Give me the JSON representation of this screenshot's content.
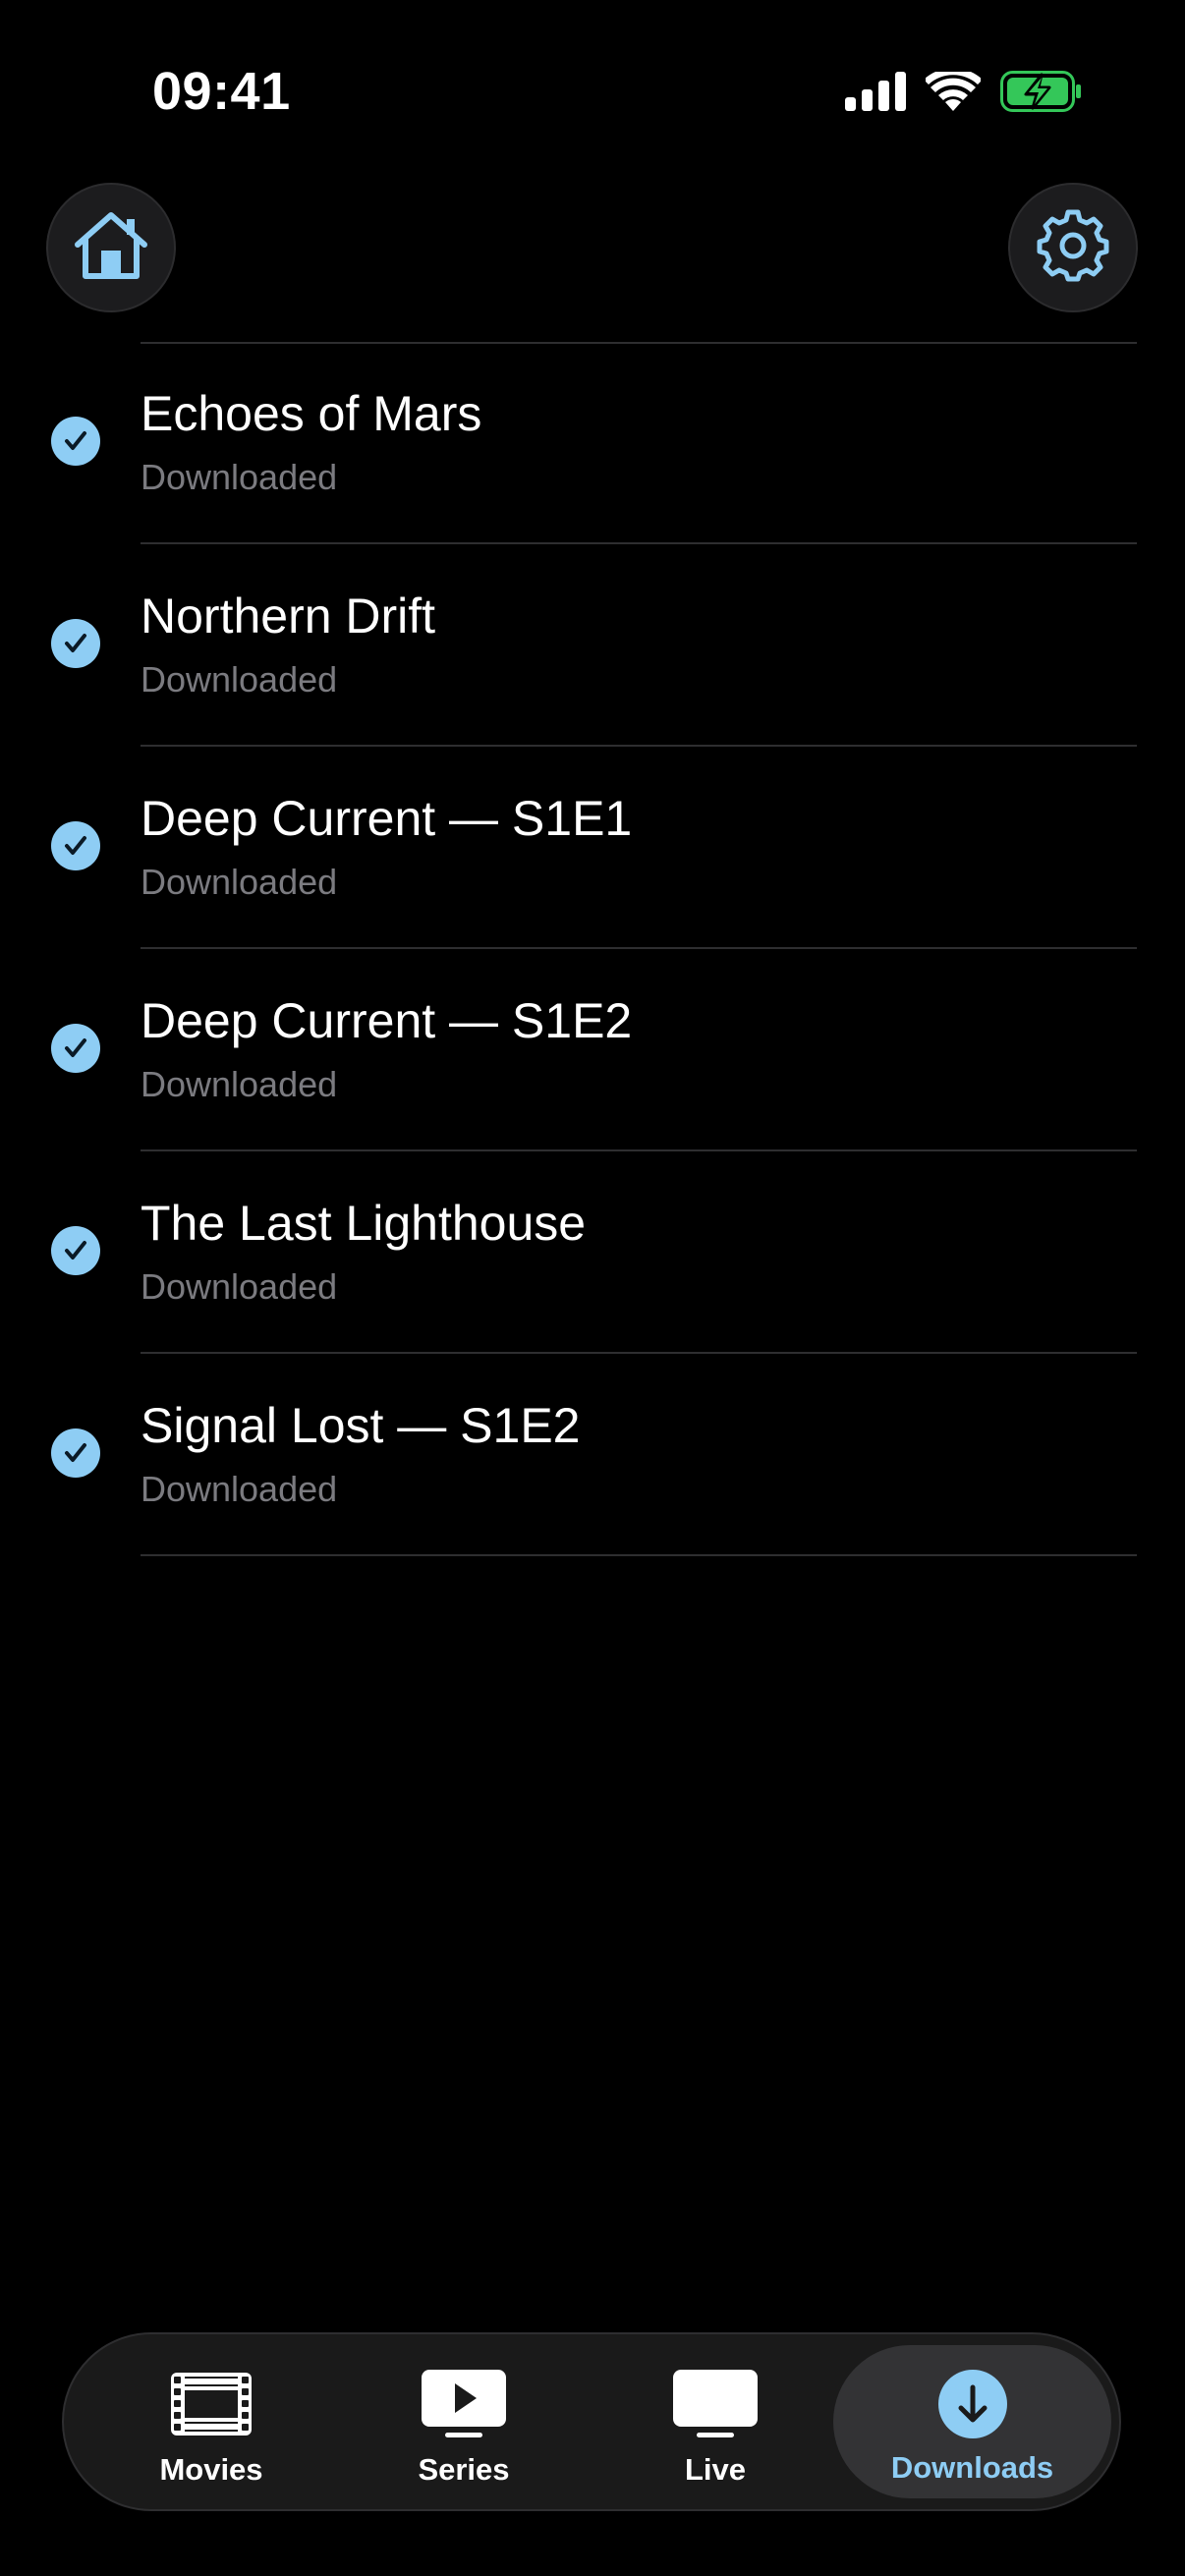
{
  "status_bar": {
    "time": "09:41"
  },
  "header": {
    "home_icon": "house-icon",
    "settings_icon": "gear-icon"
  },
  "downloads": {
    "items": [
      {
        "title": "Echoes of Mars",
        "status": "Downloaded"
      },
      {
        "title": "Northern Drift",
        "status": "Downloaded"
      },
      {
        "title": "Deep Current — S1E1",
        "status": "Downloaded"
      },
      {
        "title": "Deep Current — S1E2",
        "status": "Downloaded"
      },
      {
        "title": "The Last Lighthouse",
        "status": "Downloaded"
      },
      {
        "title": "Signal Lost — S1E2",
        "status": "Downloaded"
      }
    ]
  },
  "tab_bar": {
    "tabs": [
      {
        "label": "Movies",
        "icon": "film-icon"
      },
      {
        "label": "Series",
        "icon": "play-icon"
      },
      {
        "label": "Live",
        "icon": "tv-icon"
      },
      {
        "label": "Downloads",
        "icon": "download-icon",
        "selected": true
      }
    ]
  },
  "colors": {
    "accent": "#8ecdf4",
    "background": "#000000",
    "secondary_text": "#7b7b80",
    "battery": "#34c759"
  }
}
